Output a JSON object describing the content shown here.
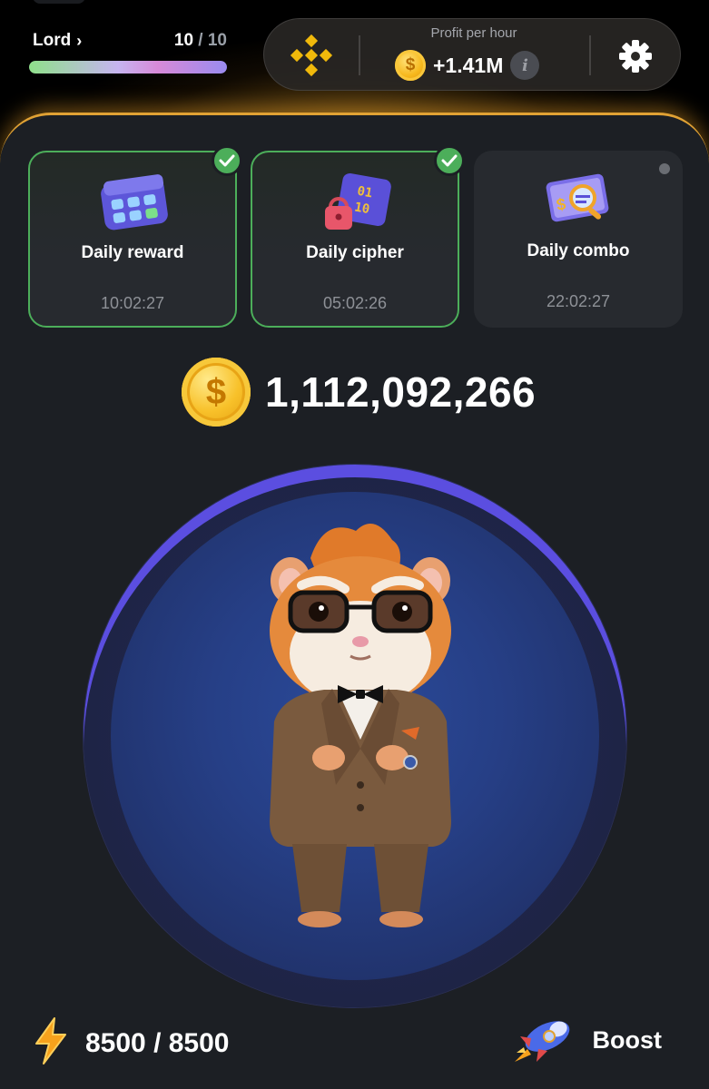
{
  "header": {
    "level_name": "Lord",
    "level_current": "10",
    "level_separator": "/",
    "level_max": "10",
    "level_progress": 1.0,
    "profit_label": "Profit per hour",
    "profit_value": "+1.41M",
    "info_icon_text": "i",
    "coin_symbol": "$"
  },
  "daily_cards": [
    {
      "title": "Daily reward",
      "timer": "10:02:27",
      "completed": true,
      "icon": "calendar-icon"
    },
    {
      "title": "Daily cipher",
      "timer": "05:02:26",
      "completed": true,
      "icon": "cipher-lock-icon"
    },
    {
      "title": "Daily combo",
      "timer": "22:02:27",
      "completed": false,
      "icon": "combo-card-icon"
    }
  ],
  "balance": {
    "value": "1,112,092,266",
    "coin_symbol": "$"
  },
  "energy": {
    "value": "8500 / 8500",
    "icon": "lightning-icon"
  },
  "boost": {
    "label": "Boost",
    "icon": "rocket-icon"
  },
  "colors": {
    "accent_gold": "#e1a234",
    "check_green": "#4cae5a",
    "tap_ring": "#5b4ee0",
    "panel_bg": "#1c1f24",
    "card_bg": "#272a2f"
  }
}
